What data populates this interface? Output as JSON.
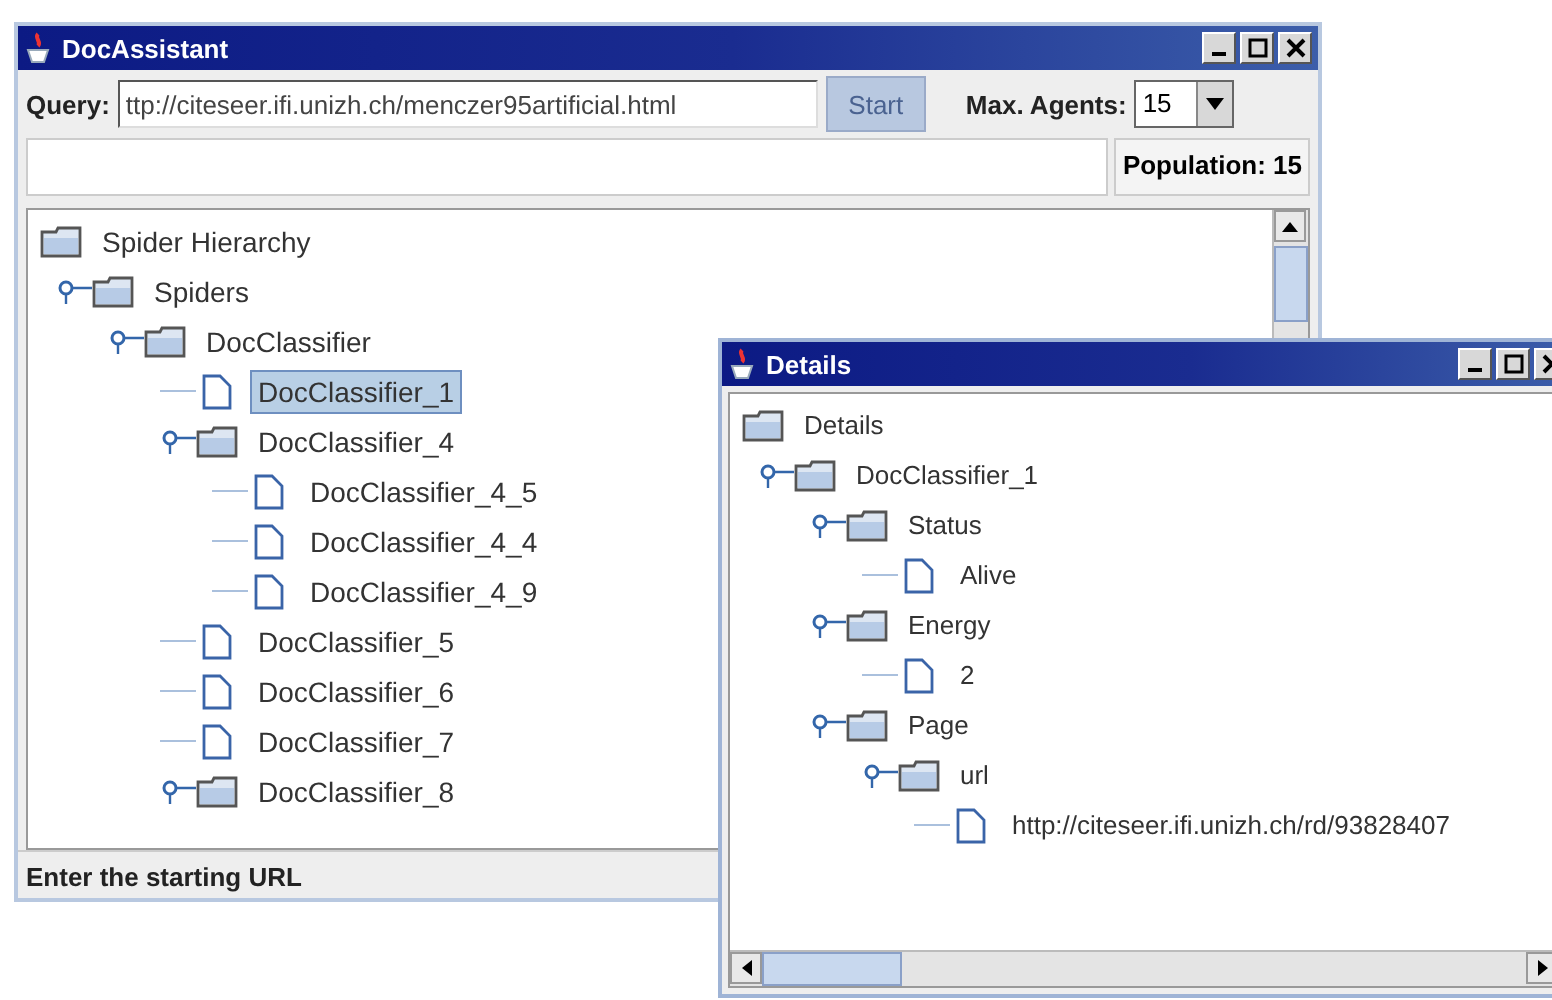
{
  "main_window": {
    "title": "DocAssistant",
    "query": {
      "label": "Query:",
      "value": "ttp://citeseer.ifi.unizh.ch/menczer95artificial.html"
    },
    "start_button": {
      "label": "Start",
      "disabled": true
    },
    "max_agents": {
      "label": "Max. Agents:",
      "value": "15"
    },
    "population": "Population: 15",
    "tree": [
      {
        "label": "Spider Hierarchy",
        "kind": "folder",
        "selected": false,
        "children": [
          {
            "label": "Spiders",
            "kind": "folder",
            "expanded": true,
            "selected": false,
            "children": [
              {
                "label": "DocClassifier",
                "kind": "folder",
                "expanded": true,
                "selected": false,
                "children": [
                  {
                    "label": "DocClassifier_1",
                    "kind": "leaf",
                    "selected": true
                  },
                  {
                    "label": "DocClassifier_4",
                    "kind": "folder",
                    "expanded": true,
                    "selected": false,
                    "children": [
                      {
                        "label": "DocClassifier_4_5",
                        "kind": "leaf",
                        "selected": false
                      },
                      {
                        "label": "DocClassifier_4_4",
                        "kind": "leaf",
                        "selected": false
                      },
                      {
                        "label": "DocClassifier_4_9",
                        "kind": "leaf",
                        "selected": false
                      }
                    ]
                  },
                  {
                    "label": "DocClassifier_5",
                    "kind": "leaf",
                    "selected": false
                  },
                  {
                    "label": "DocClassifier_6",
                    "kind": "leaf",
                    "selected": false
                  },
                  {
                    "label": "DocClassifier_7",
                    "kind": "leaf",
                    "selected": false
                  },
                  {
                    "label": "DocClassifier_8",
                    "kind": "folder",
                    "expanded": true,
                    "selected": false
                  }
                ]
              }
            ]
          }
        ]
      }
    ],
    "status_bar": "Enter the starting URL"
  },
  "details_window": {
    "title": "Details",
    "tree": [
      {
        "label": "Details",
        "kind": "folder",
        "selected": false,
        "children": [
          {
            "label": "DocClassifier_1",
            "kind": "folder",
            "expanded": true,
            "selected": false,
            "children": [
              {
                "label": "Status",
                "kind": "folder",
                "expanded": true,
                "selected": false,
                "children": [
                  {
                    "label": "Alive",
                    "kind": "leaf",
                    "selected": false
                  }
                ]
              },
              {
                "label": "Energy",
                "kind": "folder",
                "expanded": true,
                "selected": false,
                "children": [
                  {
                    "label": "2",
                    "kind": "leaf",
                    "selected": false
                  }
                ]
              },
              {
                "label": "Page",
                "kind": "folder",
                "expanded": true,
                "selected": false,
                "children": [
                  {
                    "label": "url",
                    "kind": "folder",
                    "expanded": true,
                    "selected": false,
                    "children": [
                      {
                        "label": "http://citeseer.ifi.unizh.ch/rd/93828407",
                        "kind": "leaf",
                        "selected": false
                      }
                    ]
                  }
                ]
              }
            ]
          }
        ]
      }
    ]
  }
}
